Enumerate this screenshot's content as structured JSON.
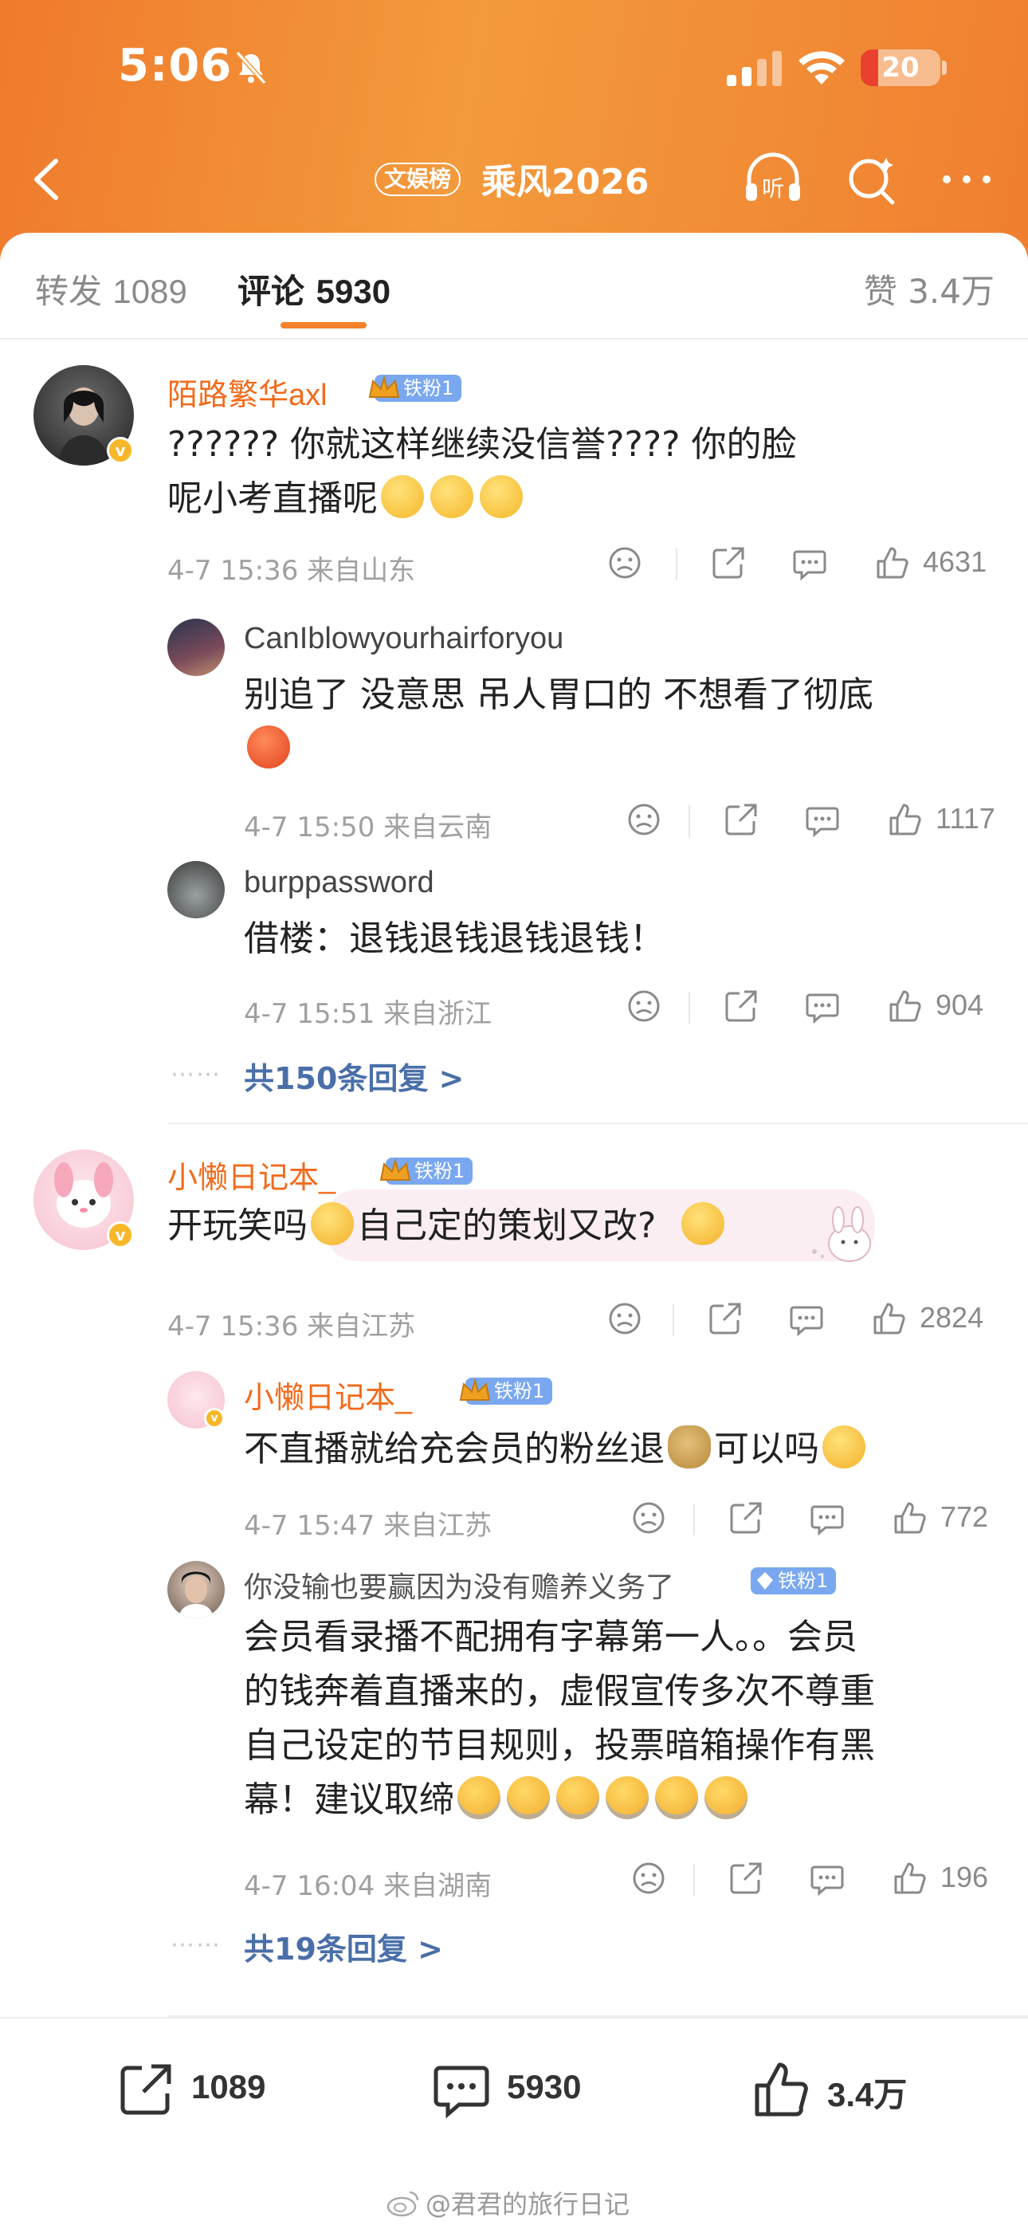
{
  "status": {
    "time": "5:06",
    "battery": "20"
  },
  "nav": {
    "tag": "文娱榜",
    "title": "乘风2026"
  },
  "tabs": {
    "repost_label": "转发",
    "repost_count": "1089",
    "comment_label": "评论",
    "comment_count": "5930",
    "likes_label": "赞",
    "likes_count": "3.4万"
  },
  "comments": [
    {
      "user": "陌路繁华axl",
      "badge": "铁粉1",
      "text_line1": "??????  你就这样继续没信誉????  你的脸",
      "text_line2": "呢小考直播呢",
      "meta": "4-7 15:36  来自山东",
      "likes": "4631",
      "replies": [
        {
          "user": "CanIblowyourhairforyou",
          "text_line1": "别追了 没意思 吊人胃口的 不想看了彻底",
          "meta": "4-7 15:50  来自云南",
          "likes": "1117"
        },
        {
          "user": "burppassword",
          "text_line1": "借楼：退钱退钱退钱退钱！",
          "meta": "4-7 15:51  来自浙江",
          "likes": "904"
        }
      ],
      "more_replies": "共150条回复 >"
    },
    {
      "user": "小懒日记本_",
      "badge": "铁粉1",
      "text_a": "开玩笑吗",
      "text_b": "自己定的策划又改?",
      "meta": "4-7 15:36  来自江苏",
      "likes": "2824",
      "replies": [
        {
          "user": "小懒日记本_",
          "badge": "铁粉1",
          "text_a": "不直播就给充会员的粉丝退",
          "text_b": "可以吗",
          "meta": "4-7 15:47  来自江苏",
          "likes": "772"
        },
        {
          "user": "你没输也要赢因为没有赡养义务了",
          "badge": "铁粉1",
          "text_line1": "会员看录播不配拥有字幕第一人。。会员",
          "text_line2": "的钱奔着直播来的，虚假宣传多次不尊重",
          "text_line3": "自己设定的节目规则，投票暗箱操作有黑",
          "text_line4": "幕！建议取缔",
          "meta": "4-7 16:04  来自湖南",
          "likes": "196"
        }
      ],
      "more_replies": "共19条回复 >"
    }
  ],
  "bottom": {
    "repost": "1089",
    "comment": "5930",
    "like": "3.4万"
  },
  "watermark": "@君君的旅行日记",
  "colors": {
    "header": "#f39a3c",
    "accent": "#f26a1b",
    "link": "#4a6fa8",
    "fan_badge": "#7aa8f0"
  },
  "icons": [
    "bell-slash-icon",
    "signal-icon",
    "wifi-icon",
    "back-icon",
    "listen-icon",
    "search-icon",
    "more-icon",
    "dislike-icon",
    "share-icon",
    "comment-icon",
    "like-icon",
    "crown-icon"
  ]
}
